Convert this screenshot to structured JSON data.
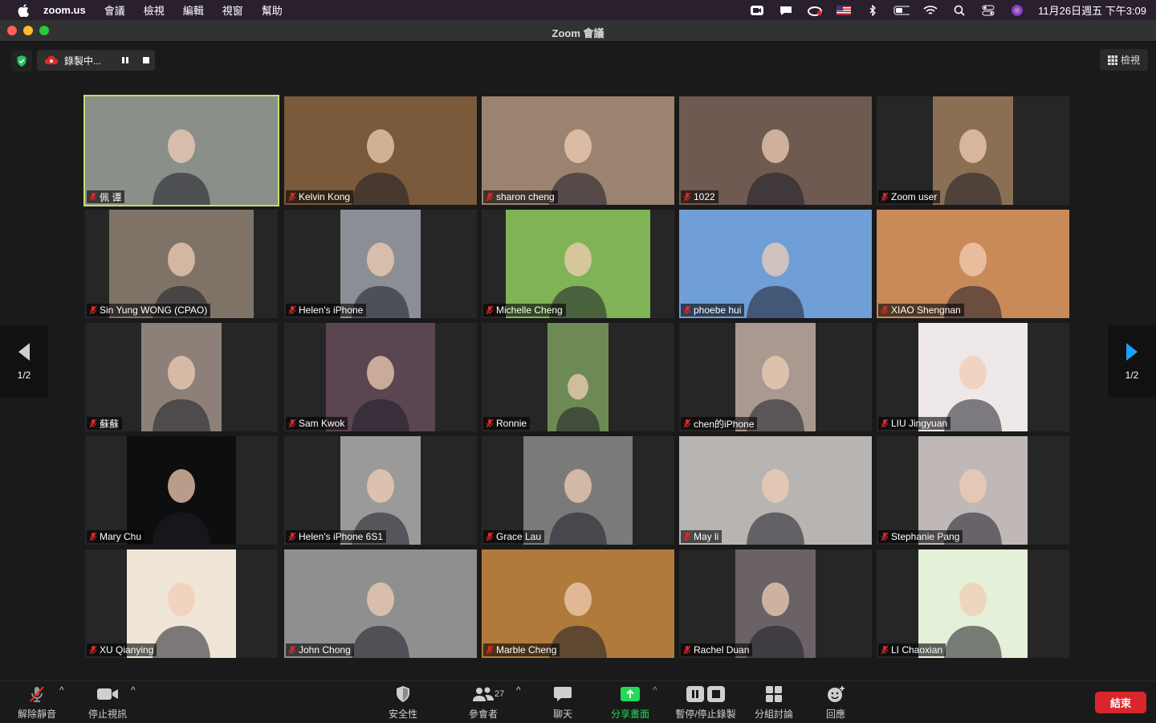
{
  "menubar": {
    "app": "zoom.us",
    "items": [
      "會議",
      "檢視",
      "編輯",
      "視窗",
      "幫助"
    ],
    "clock": "11月26日週五 下午3:09"
  },
  "window": {
    "title": "Zoom 會議"
  },
  "recording": {
    "label": "錄製中..."
  },
  "view_button": {
    "label": "檢視"
  },
  "pagination": {
    "left": "1/2",
    "right": "1/2"
  },
  "participants": [
    {
      "name": "佩 谭",
      "video_color": "#8a8f8a"
    },
    {
      "name": "Kelvin Kong",
      "video_color": "#7a5a3a"
    },
    {
      "name": "sharon cheng",
      "video_color": "#9c8270"
    },
    {
      "name": "1022",
      "video_color": "#6e5a50"
    },
    {
      "name": "Zoom user",
      "video_color": "#8a6f52"
    },
    {
      "name": "Sin Yung WONG (CPAO)",
      "video_color": "#7e7366"
    },
    {
      "name": "Helen's iPhone",
      "video_color": "#8b8f95"
    },
    {
      "name": "Michelle Cheng",
      "video_color": "#7fb356"
    },
    {
      "name": "phoebe hui",
      "video_color": "#6f9fd6"
    },
    {
      "name": "XIAO Shengnan",
      "video_color": "#c98a5a"
    },
    {
      "name": "蘇蘇",
      "video_color": "#8c8078"
    },
    {
      "name": "Sam Kwok",
      "video_color": "#5a4550"
    },
    {
      "name": "Ronnie",
      "video_color": "#6e8a54"
    },
    {
      "name": "chen的iPhone",
      "video_color": "#a89a90"
    },
    {
      "name": "LIU Jingyuan",
      "video_color": "#efe8e8"
    },
    {
      "name": "Mary Chu",
      "video_color": "#0e0e0e"
    },
    {
      "name": "Helen's iPhone 6S1",
      "video_color": "#9a9a9a"
    },
    {
      "name": "Grace Lau",
      "video_color": "#7a7a7a"
    },
    {
      "name": "May li",
      "video_color": "#b8b4b2"
    },
    {
      "name": "Stephanie Pang",
      "video_color": "#c0b8b6"
    },
    {
      "name": "XU Qianying",
      "video_color": "#efe6d8"
    },
    {
      "name": "John Chong",
      "video_color": "#8e9090"
    },
    {
      "name": "Marble Cheng",
      "video_color": "#b07a3a"
    },
    {
      "name": "Rachel Duan",
      "video_color": "#6a6266"
    },
    {
      "name": "LI Chaoxian",
      "video_color": "#e4f0d8"
    }
  ],
  "toolbar": {
    "unmute": "解除靜音",
    "stop_video": "停止視訊",
    "security": "安全性",
    "participants": "參會者",
    "participant_count": "27",
    "chat": "聊天",
    "share": "分享畫面",
    "record": "暫停/停止錄製",
    "breakout": "分組討論",
    "reactions": "回應",
    "end": "結束"
  },
  "colors": {
    "active_speaker": "#c4dc6d",
    "share_green": "#23d959",
    "end_red": "#d9262c",
    "mute_red": "#e02828"
  }
}
